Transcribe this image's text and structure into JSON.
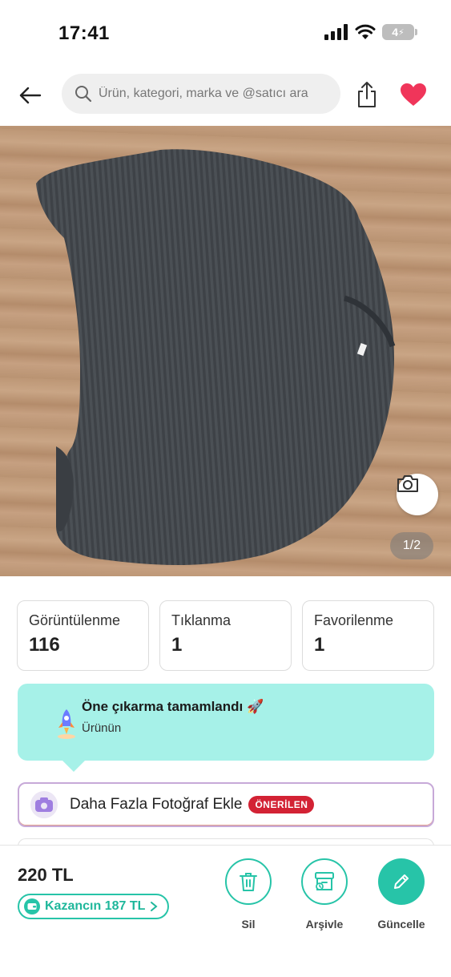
{
  "status_bar": {
    "time": "17:41",
    "battery": "4"
  },
  "header": {
    "search_placeholder": "Ürün, kategori, marka ve @satıcı ara",
    "favorite_color": "#f0355a"
  },
  "gallery": {
    "page_indicator": "1/2"
  },
  "stats": [
    {
      "label": "Görüntülenme",
      "value": "116"
    },
    {
      "label": "Tıklanma",
      "value": "1"
    },
    {
      "label": "Favorilenme",
      "value": "1"
    }
  ],
  "boost": {
    "title": "Öne çıkarma tamamlandı 🚀",
    "subtitle": "Ürünün",
    "background": "#a6f1e8"
  },
  "add_photo": {
    "label": "Daha Fazla Fotoğraf Ekle",
    "badge": "ÖNERİLEN"
  },
  "bottom_bar": {
    "price": "220 TL",
    "earnings": "Kazancın 187 TL",
    "accent": "#27c4a8",
    "actions": [
      {
        "label": "Sil",
        "icon": "trash-icon"
      },
      {
        "label": "Arşivle",
        "icon": "archive-icon"
      },
      {
        "label": "Güncelle",
        "icon": "pencil-icon"
      }
    ]
  }
}
